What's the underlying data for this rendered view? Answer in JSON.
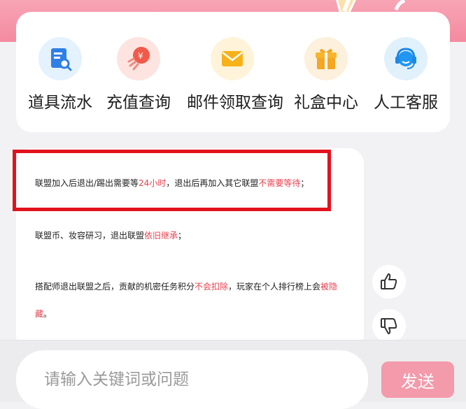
{
  "quick_actions": [
    {
      "label": "道具流水",
      "icon": "item-log-icon"
    },
    {
      "label": "充值查询",
      "icon": "recharge-rocket-icon"
    },
    {
      "label": "邮件领取查询",
      "icon": "mail-envelope-icon"
    },
    {
      "label": "礼盒中心",
      "icon": "gift-box-icon"
    },
    {
      "label": "人工客服",
      "icon": "customer-service-headset-icon"
    }
  ],
  "answer": {
    "p1": {
      "a": "联盟加入后退出/踢出需要等",
      "b": "24小时",
      "c": "，退出后再加入其它联盟",
      "d": "不需要等待",
      "e": "；"
    },
    "p2": {
      "a": "联盟币、妆容研习，退出联盟",
      "b": "依旧继承",
      "c": "；"
    },
    "p3": {
      "a": "搭配师退出联盟之后，贡献的机密任务积分",
      "b": "不会扣除",
      "c": "，玩家在个人排行榜上会",
      "d": "被隐",
      "e": "藏",
      "f": "。"
    }
  },
  "feedback": {
    "like_icon": "thumbs-up-icon",
    "dislike_icon": "thumbs-down-icon"
  },
  "input": {
    "placeholder": "请输入关键词或问题",
    "value": ""
  },
  "send_label": "发送",
  "colors": {
    "accent_pink": "#f39aab",
    "highlight_red": "#e8414e",
    "box_red": "#e2121d"
  }
}
